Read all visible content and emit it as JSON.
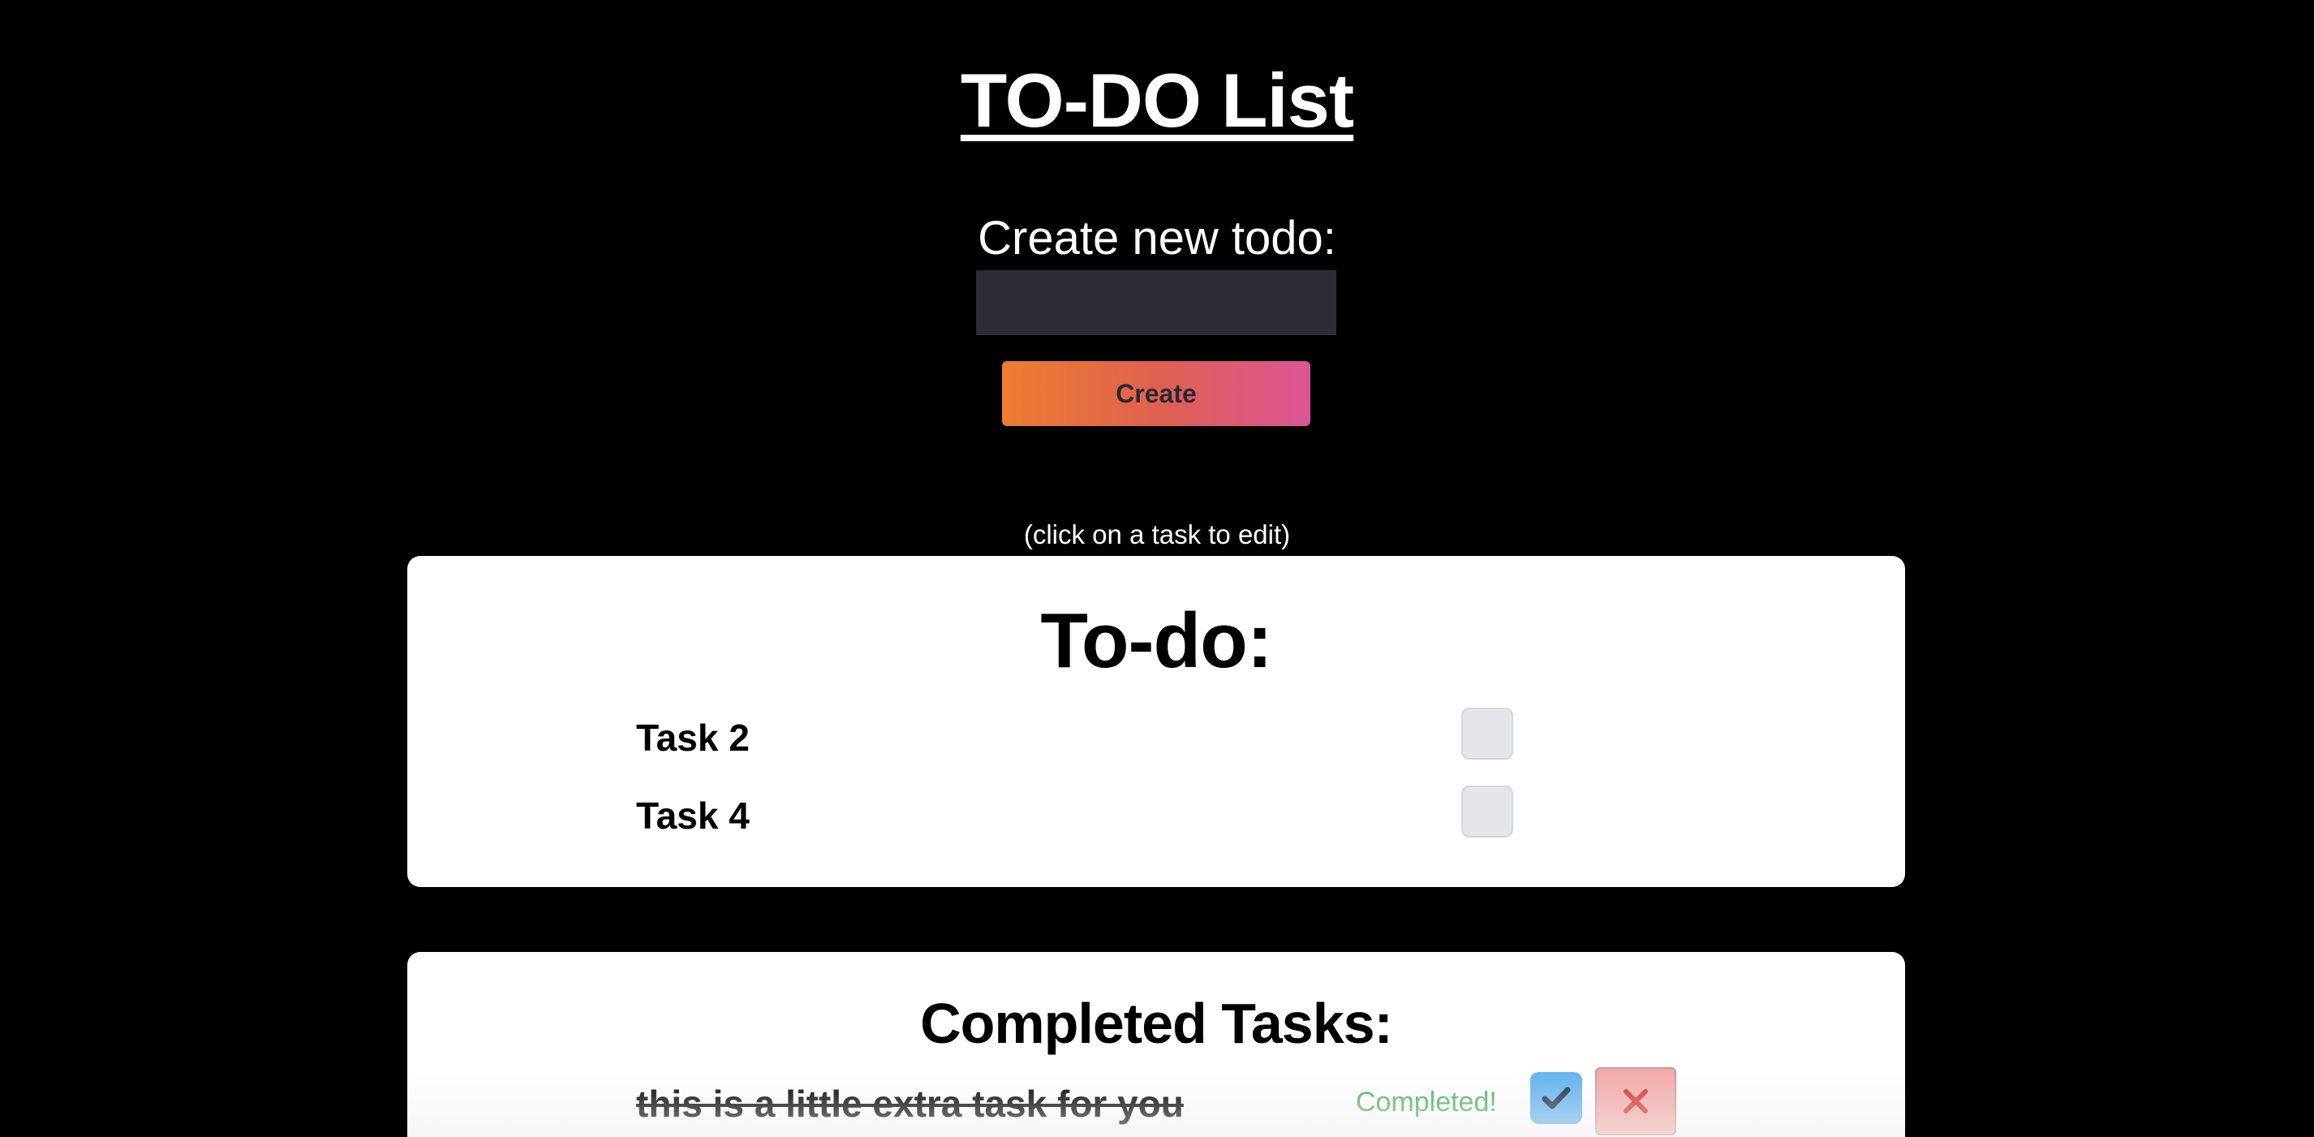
{
  "header": {
    "title": "TO-DO List"
  },
  "create_form": {
    "label": "Create new todo:",
    "input_value": "",
    "input_placeholder": "",
    "button_label": "Create",
    "button_gradient": [
      "#ec7d32",
      "#db5597"
    ]
  },
  "hint": "(click on a task to edit)",
  "todo_section": {
    "title": "To-do:",
    "tasks": [
      {
        "label": "Task 2",
        "checked": false
      },
      {
        "label": "Task 4",
        "checked": false
      }
    ]
  },
  "completed_section": {
    "title": "Completed Tasks:",
    "tasks": [
      {
        "label": "this is a little extra task for you",
        "status": "Completed!",
        "confirm_icon": "checkmark-icon",
        "delete_icon": "close-icon"
      }
    ]
  },
  "colors": {
    "background": "#000000",
    "card": "#ffffff",
    "input_bg": "#2d2c37",
    "status_green": "#4bb35b",
    "confirm_blue": "#63b3ed",
    "delete_red_bg": "#f4aaaa",
    "delete_red_icon": "#d6312b"
  }
}
